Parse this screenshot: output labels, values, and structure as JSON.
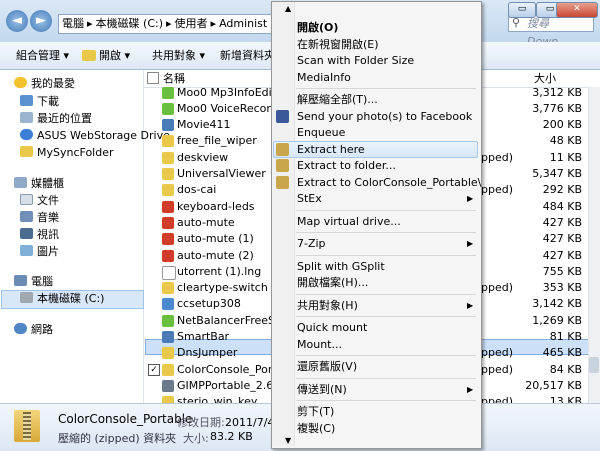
{
  "window": {
    "address": [
      "電腦",
      "本機磁碟 (C:)",
      "使用者",
      "Administ"
    ],
    "search_placeholder": "搜尋 Down...",
    "buttons": {
      "minimize": "▭",
      "maximize": "▭",
      "close": "✕"
    }
  },
  "toolbar": {
    "organize": "組合管理 ▾",
    "open": "開啟 ▾",
    "share": "共用對象 ▾",
    "new_folder": "新增資料夾"
  },
  "navpane": {
    "favorites_title": "我的最愛",
    "favorites": [
      "下載",
      "最近的位置",
      "ASUS WebStorage Drive",
      "MySyncFolder"
    ],
    "libraries_title": "媒體櫃",
    "libraries": [
      "文件",
      "音樂",
      "視訊",
      "圖片"
    ],
    "computer_title": "電腦",
    "computer": [
      "本機磁碟 (C:)"
    ],
    "network_title": "網路"
  },
  "filelist": {
    "col_name": "名稱",
    "col_size": "大小",
    "files": [
      {
        "name": "Moo0 Mp3InfoEditor 1",
        "type": "",
        "size": "3,312 KB",
        "color": "#6abf3f"
      },
      {
        "name": "Moo0 VoiceRecorder",
        "type": "",
        "size": "3,776 KB",
        "color": "#6abf3f"
      },
      {
        "name": "Movie411",
        "type": "",
        "size": "200 KB",
        "color": "#4a7ab8"
      },
      {
        "name": "free_file_wiper",
        "type": "",
        "size": "48 KB",
        "color": "#e9c84a"
      },
      {
        "name": "deskview",
        "type": "pped)",
        "size": "11 KB",
        "color": "#e9c84a"
      },
      {
        "name": "UniversalViewer",
        "type": "",
        "size": "5,347 KB",
        "color": "#e9c84a"
      },
      {
        "name": "dos-cai",
        "type": "pped)",
        "size": "292 KB",
        "color": "#e9c84a"
      },
      {
        "name": "keyboard-leds",
        "type": "",
        "size": "484 KB",
        "color": "#d23a2a"
      },
      {
        "name": "auto-mute",
        "type": "",
        "size": "427 KB",
        "color": "#d23a2a"
      },
      {
        "name": "auto-mute (1)",
        "type": "",
        "size": "427 KB",
        "color": "#d23a2a"
      },
      {
        "name": "auto-mute (2)",
        "type": "",
        "size": "427 KB",
        "color": "#d23a2a"
      },
      {
        "name": "utorrent (1).lng",
        "type": "",
        "size": "755 KB",
        "color": "#ffffff"
      },
      {
        "name": "cleartype-switch",
        "type": "pped)",
        "size": "353 KB",
        "color": "#e9c84a"
      },
      {
        "name": "ccsetup308",
        "type": "",
        "size": "3,142 KB",
        "color": "#4a8ad0"
      },
      {
        "name": "NetBalancerFreeSetup",
        "type": "",
        "size": "1,269 KB",
        "color": "#6abf3f"
      },
      {
        "name": "SmartBar",
        "type": "",
        "size": "81 KB",
        "color": "#4a7ab8"
      },
      {
        "name": "DnsJumper",
        "type": "pped)",
        "size": "465 KB",
        "color": "#e9c84a"
      },
      {
        "name": "ColorConsole_Portable",
        "type": "pped)",
        "size": "84 KB",
        "color": "#e9c84a",
        "selected": true
      },
      {
        "name": "GIMPPortable_2.6.11_F",
        "type": "",
        "size": "20,517 KB",
        "color": "#6a7a8a"
      },
      {
        "name": "sterjo_win_key",
        "type": "pped)",
        "size": "13 KB",
        "color": "#e9c84a"
      }
    ]
  },
  "details": {
    "name": "ColorConsole_Portable",
    "modified_label": "修改日期:",
    "modified_value": "2011/7/4 上午",
    "type": "壓縮的 (zipped) 資料夾",
    "size_label": "大小:",
    "size_value": "83.2 KB"
  },
  "menu": {
    "scroll_up": "▲",
    "scroll_down": "▼",
    "items": [
      {
        "label": "開啟(O)",
        "bold": true
      },
      {
        "label": "在新視窗開啟(E)"
      },
      {
        "label": "Scan with Folder Size"
      },
      {
        "label": "MediaInfo"
      },
      {
        "sep": true
      },
      {
        "label": "解壓縮全部(T)..."
      },
      {
        "label": "Send your photo(s) to Facebook",
        "icon": "#3b5998"
      },
      {
        "label": "Enqueue"
      },
      {
        "label": "Extract here",
        "icon": "#c9a64b",
        "hover": true
      },
      {
        "label": "Extract to folder...",
        "icon": "#c9a64b"
      },
      {
        "label": "Extract to ColorConsole_Portable\\",
        "icon": "#c9a64b"
      },
      {
        "label": "StEx",
        "sub": true
      },
      {
        "sep": true
      },
      {
        "label": "Map virtual drive..."
      },
      {
        "sep": true
      },
      {
        "label": "7-Zip",
        "sub": true
      },
      {
        "sep": true
      },
      {
        "label": "Split with GSplit"
      },
      {
        "label": "開啟檔案(H)..."
      },
      {
        "sep": true
      },
      {
        "label": "共用對象(H)",
        "sub": true
      },
      {
        "sep": true
      },
      {
        "label": "Quick mount"
      },
      {
        "label": "Mount..."
      },
      {
        "sep": true
      },
      {
        "label": "還原舊版(V)"
      },
      {
        "sep": true
      },
      {
        "label": "傳送到(N)",
        "sub": true
      },
      {
        "sep": true
      },
      {
        "label": "剪下(T)"
      },
      {
        "label": "複製(C)"
      }
    ]
  }
}
